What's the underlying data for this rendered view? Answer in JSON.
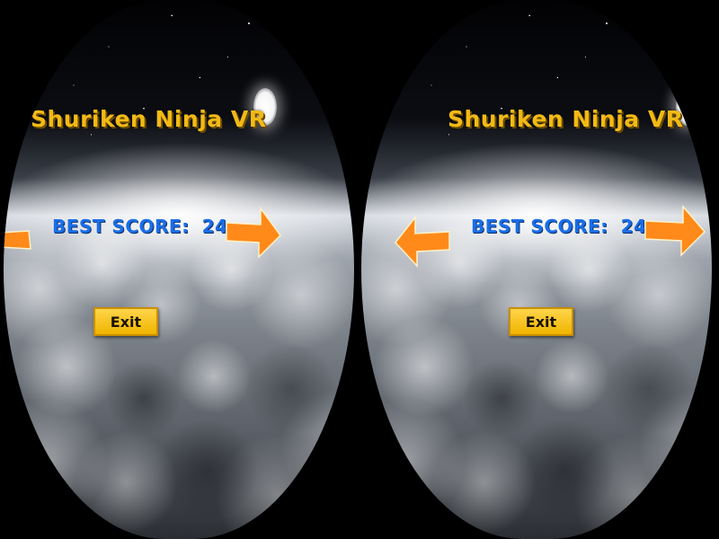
{
  "game": {
    "title": "Shuriken Ninja VR",
    "best_score_label": "BEST SCORE:",
    "best_score_value": "24",
    "exit_label": "Exit"
  },
  "colors": {
    "title": "#f2ba16",
    "score": "#1a6ee8",
    "exit_button": "#f5c518",
    "arrow": "#ff8a1a"
  },
  "icons": {
    "left_arrow": "arrow-left-icon",
    "right_arrow": "arrow-right-icon",
    "moon": "moon-icon"
  }
}
